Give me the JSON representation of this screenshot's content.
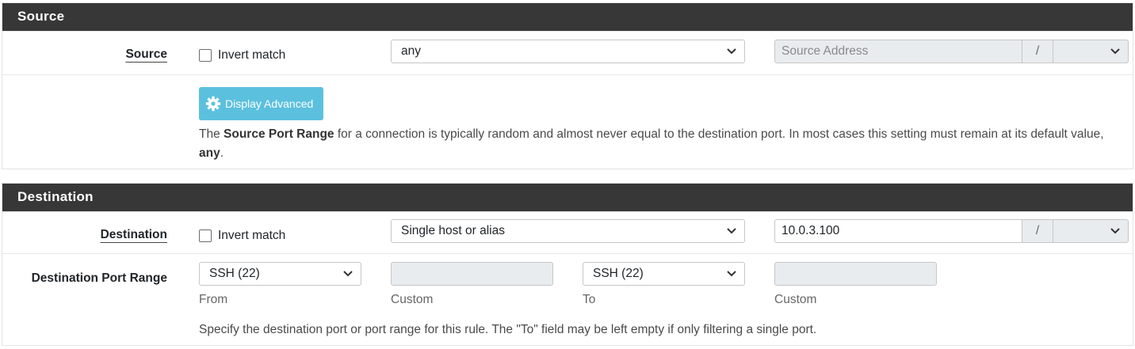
{
  "source": {
    "heading": "Source",
    "label": "Source",
    "invert_label": "Invert match",
    "type_value": "any",
    "address_placeholder": "Source Address",
    "slash": "/",
    "mask_value": "",
    "advanced_button": "Display Advanced",
    "help_pre": "The ",
    "help_bold": "Source Port Range",
    "help_mid": " for a connection is typically random and almost never equal to the destination port. In most cases this setting must remain at its default value, ",
    "help_bold2": "any",
    "help_post": "."
  },
  "destination": {
    "heading": "Destination",
    "label": "Destination",
    "invert_label": "Invert match",
    "type_value": "Single host or alias",
    "address_value": "10.0.3.100",
    "slash": "/",
    "mask_value": "",
    "port_label": "Destination Port Range",
    "from_value": "SSH (22)",
    "from_sub": "From",
    "from_custom_sub": "Custom",
    "to_value": "SSH (22)",
    "to_sub": "To",
    "to_custom_sub": "Custom",
    "help": "Specify the destination port or port range for this rule. The \"To\" field may be left empty if only filtering a single port."
  },
  "colors": {
    "heading_bg": "#373737",
    "button_bg": "#5bc0de",
    "disabled_bg": "#e9ecef"
  }
}
